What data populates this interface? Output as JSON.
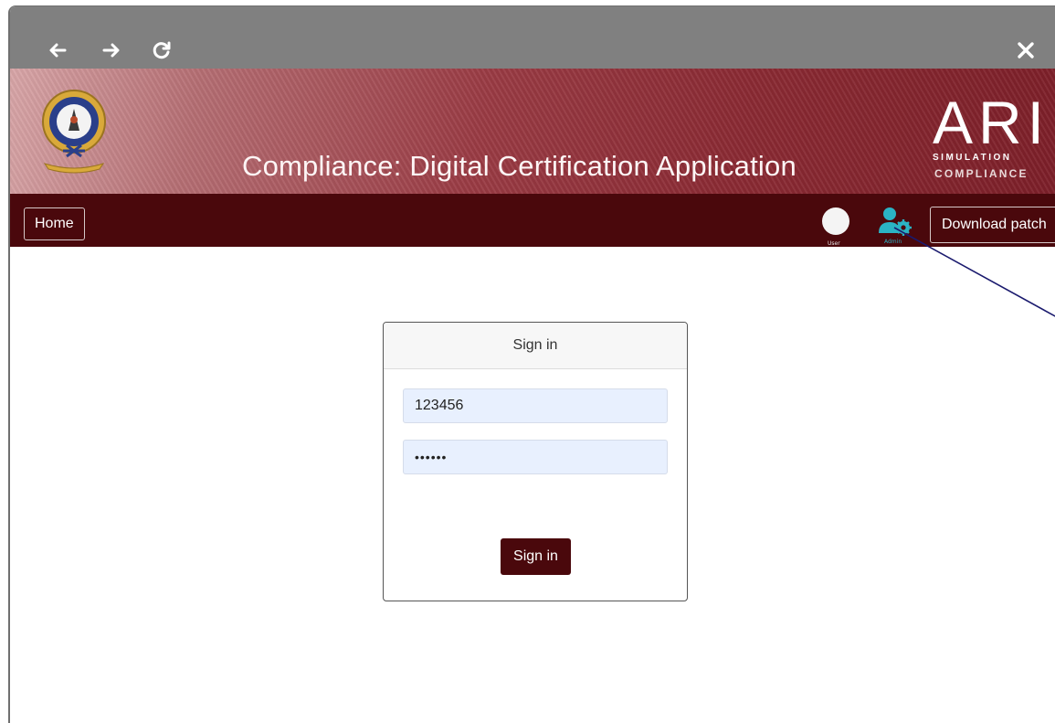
{
  "browser": {
    "back_icon": "arrow-left-icon",
    "forward_icon": "arrow-right-icon",
    "reload_icon": "reload-icon",
    "close_icon": "close-icon"
  },
  "banner": {
    "title": "Compliance: Digital Certification Application",
    "ari_logo": {
      "mark": "ARI",
      "line1": "SIMULATION",
      "line2": "COMPLIANCE"
    }
  },
  "navbar": {
    "home_label": "Home",
    "user_label": "User",
    "admin_label": "Admin",
    "download_label": "Download patch"
  },
  "signin": {
    "header": "Sign in",
    "username_value": "123456",
    "password_value": "••••••",
    "submit_label": "Sign in"
  },
  "colors": {
    "navbar": "#4a080c",
    "banner": "#8a2a33",
    "admin_icon": "#2bb3c4",
    "input_bg": "#e8f0fe"
  }
}
